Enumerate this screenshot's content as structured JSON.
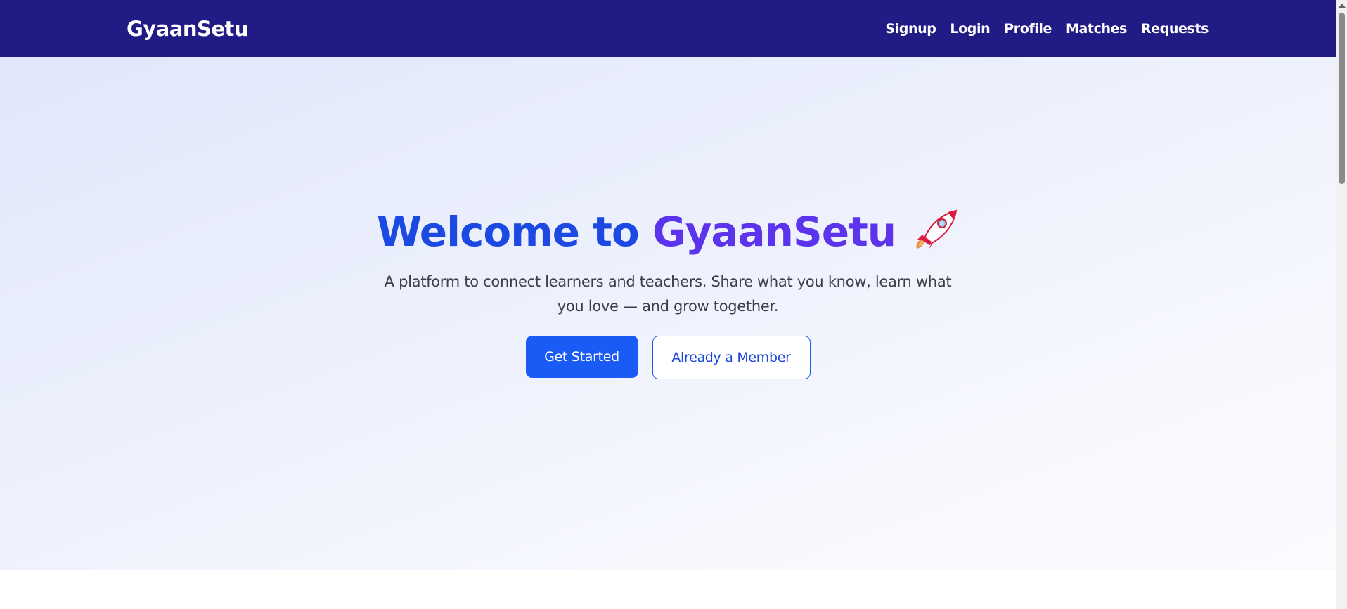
{
  "navbar": {
    "brand": "GyaanSetu",
    "links": [
      "Signup",
      "Login",
      "Profile",
      "Matches",
      "Requests"
    ]
  },
  "hero": {
    "title_prefix": "Welcome to ",
    "title_brand": "GyaanSetu",
    "title_icon": "rocket-icon",
    "subtitle": "A platform to connect learners and teachers. Share what you know, learn what you love — and grow together.",
    "primary_button": "Get Started",
    "secondary_button": "Already a Member"
  },
  "colors": {
    "navbar_bg": "#211b85",
    "title_blue": "#1d49e3",
    "title_purple": "#5b34ec",
    "primary_button_bg": "#1a5af5"
  }
}
